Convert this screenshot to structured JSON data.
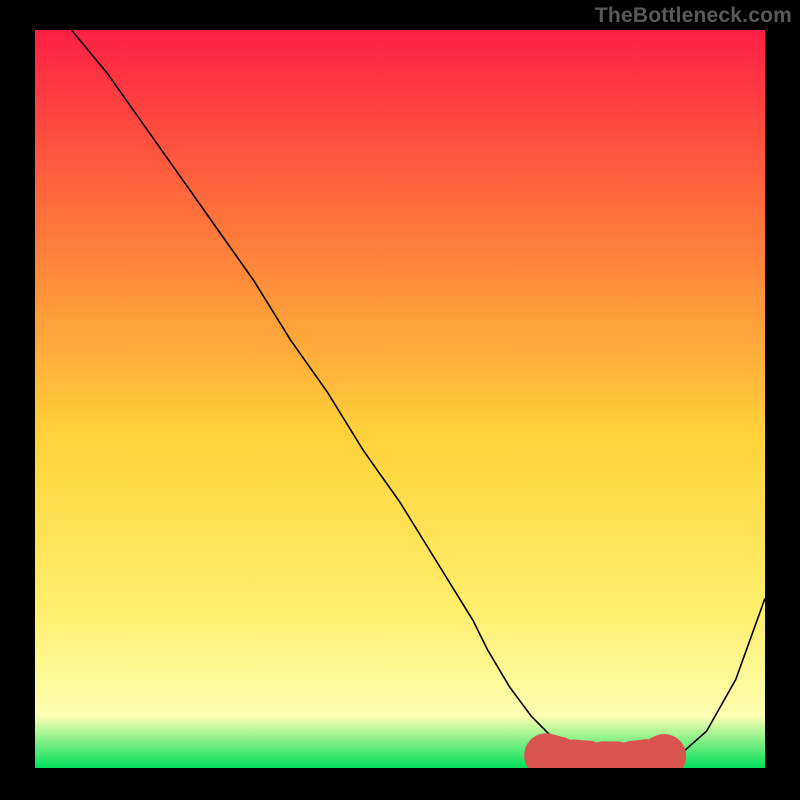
{
  "watermark": "TheBottleneck.com",
  "colors": {
    "background": "#000000",
    "gradient_top": "#ff1f44",
    "gradient_mid_upper": "#ff7a3a",
    "gradient_mid": "#ffd23a",
    "gradient_mid_lower": "#ffee6a",
    "gradient_near_bottom": "#fbffb0",
    "gradient_bottom": "#00e05a",
    "curve": "#000000",
    "marker": "#d9544d"
  },
  "chart_data": {
    "type": "line",
    "title": "",
    "xlabel": "",
    "ylabel": "",
    "xlim": [
      0,
      100
    ],
    "ylim": [
      0,
      100
    ],
    "grid": false,
    "legend": false,
    "series": [
      {
        "name": "bottleneck-curve",
        "x": [
          5,
          10,
          15,
          20,
          25,
          30,
          35,
          40,
          45,
          50,
          55,
          60,
          62,
          65,
          68,
          72,
          75,
          78,
          80,
          82,
          85,
          88,
          92,
          96,
          100
        ],
        "y": [
          100,
          94,
          87,
          80,
          73,
          66,
          58,
          51,
          43,
          36,
          28,
          20,
          16,
          11,
          7,
          3,
          1.2,
          0.6,
          0.4,
          0.4,
          0.6,
          1.5,
          5,
          12,
          23
        ]
      }
    ],
    "markers": {
      "name": "optimal-range",
      "x": [
        70,
        71.5,
        73,
        74,
        75,
        76,
        77,
        79,
        81,
        82,
        83,
        84,
        85,
        85.6,
        86.2
      ],
      "y": [
        1.7,
        1.3,
        1.0,
        0.85,
        0.75,
        0.7,
        0.65,
        0.6,
        0.6,
        0.7,
        0.8,
        0.95,
        1.15,
        1.35,
        1.6
      ]
    }
  }
}
